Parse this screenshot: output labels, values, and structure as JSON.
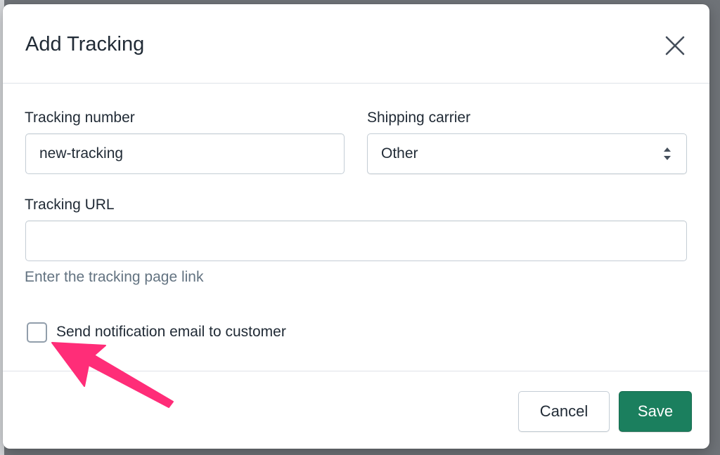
{
  "modal": {
    "title": "Add Tracking",
    "close_icon": "close-icon"
  },
  "form": {
    "tracking_number": {
      "label": "Tracking number",
      "value": "new-tracking",
      "placeholder": ""
    },
    "shipping_carrier": {
      "label": "Shipping carrier",
      "selected": "Other",
      "icon": "select-arrows-icon"
    },
    "tracking_url": {
      "label": "Tracking URL",
      "value": "",
      "help_text": "Enter the tracking page link"
    },
    "notify_customer": {
      "label": "Send notification email to customer",
      "checked": false
    }
  },
  "footer": {
    "cancel_label": "Cancel",
    "save_label": "Save"
  },
  "colors": {
    "primary": "#1b7f5e",
    "annotation_arrow": "#ff2d78",
    "text": "#212b36",
    "muted": "#637381",
    "border": "#c4cdd5"
  }
}
